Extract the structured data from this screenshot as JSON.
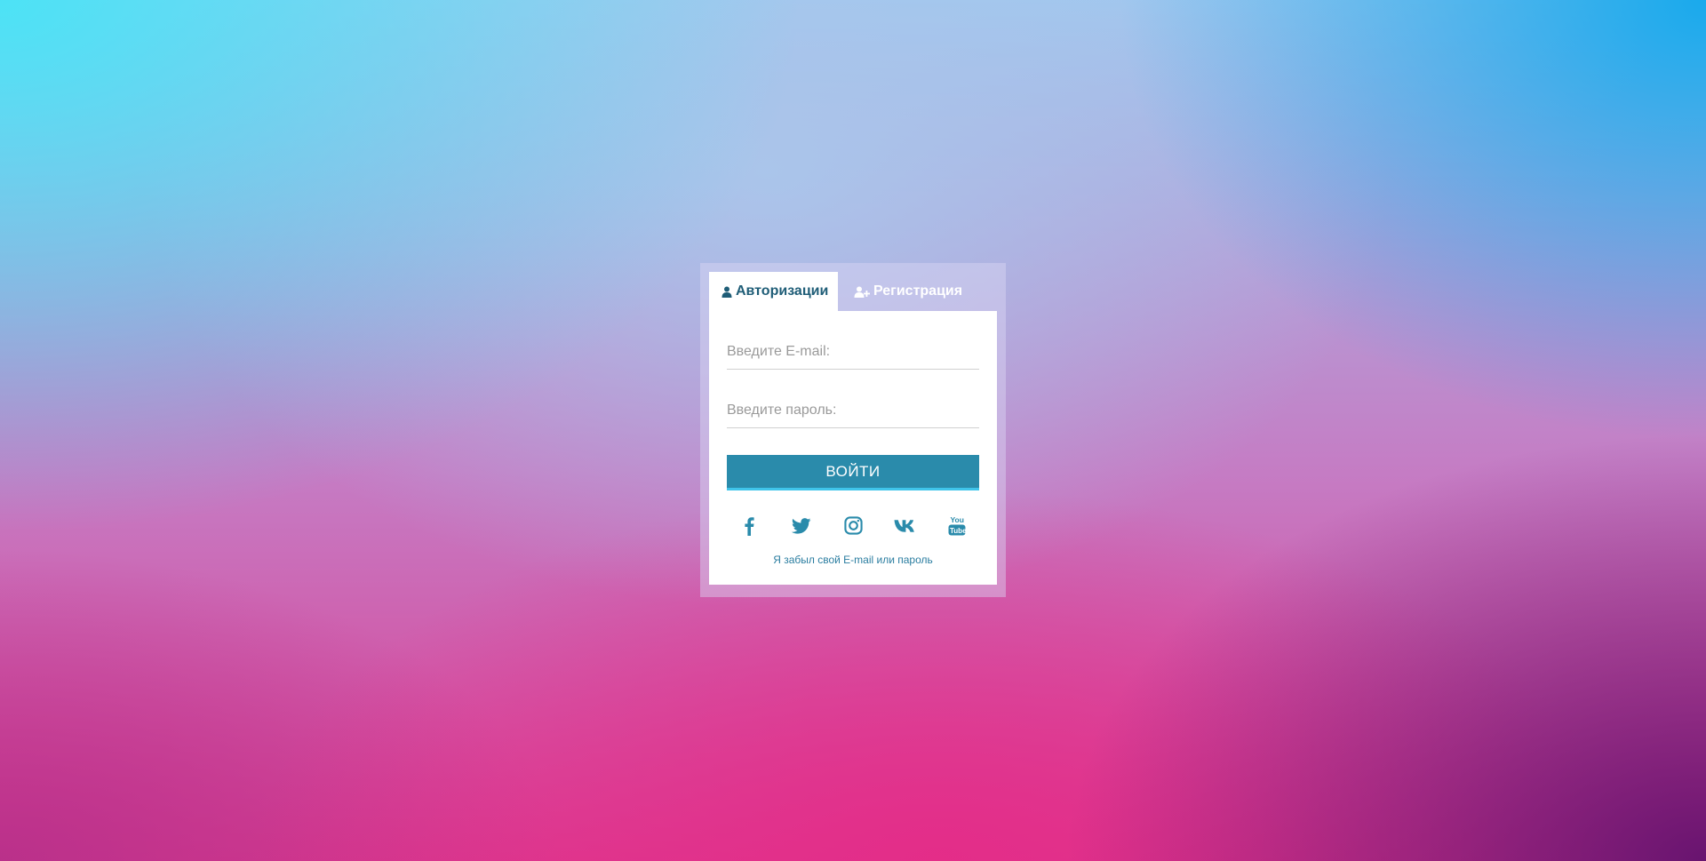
{
  "tabs": {
    "login_label": "Авторизации",
    "register_label": "Регистрация"
  },
  "form": {
    "email_placeholder": "Введите E-mail:",
    "email_value": "",
    "password_placeholder": "Введите пароль:",
    "password_value": "",
    "submit_label": "ВОЙТИ",
    "forgot_link": "Я забыл свой E-mail или пароль"
  },
  "socials": [
    {
      "icon": "facebook-icon"
    },
    {
      "icon": "twitter-icon"
    },
    {
      "icon": "instagram-icon"
    },
    {
      "icon": "vk-icon"
    },
    {
      "icon": "youtube-icon"
    }
  ],
  "colors": {
    "accent": "#2a8bab",
    "accent_border": "#3fc4ea",
    "tab_active_text": "#1f5d77",
    "link": "#2a7da0"
  }
}
